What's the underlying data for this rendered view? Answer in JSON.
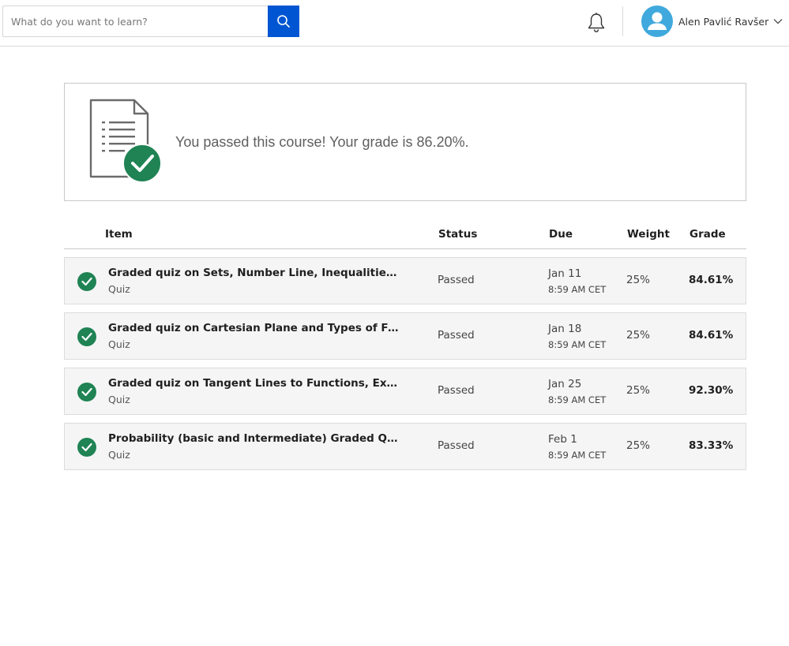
{
  "header": {
    "search_placeholder": "What do you want to learn?",
    "user_name": "Alen Pavlić Ravšer"
  },
  "banner": {
    "message": "You passed this course! Your grade is 86.20%."
  },
  "table": {
    "columns": {
      "item": "Item",
      "status": "Status",
      "due": "Due",
      "weight": "Weight",
      "grade": "Grade"
    },
    "rows": [
      {
        "title": "Graded quiz on Sets, Number Line, Inequalities, Si...",
        "type": "Quiz",
        "status": "Passed",
        "due_date": "Jan 11",
        "due_time": "8:59 AM CET",
        "weight": "25%",
        "grade": "84.61%"
      },
      {
        "title": "Graded quiz on Cartesian Plane and Types of Funct...",
        "type": "Quiz",
        "status": "Passed",
        "due_date": "Jan 18",
        "due_time": "8:59 AM CET",
        "weight": "25%",
        "grade": "84.61%"
      },
      {
        "title": "Graded quiz on Tangent Lines to Functions, Expone...",
        "type": "Quiz",
        "status": "Passed",
        "due_date": "Jan 25",
        "due_time": "8:59 AM CET",
        "weight": "25%",
        "grade": "92.30%"
      },
      {
        "title": "Probability (basic and Intermediate) Graded Quiz",
        "type": "Quiz",
        "status": "Passed",
        "due_date": "Feb 1",
        "due_time": "8:59 AM CET",
        "weight": "25%",
        "grade": "83.33%"
      }
    ]
  },
  "icons": {
    "search": "search-icon",
    "notifications": "bell-icon",
    "avatar": "user-avatar-icon",
    "menu": "chevron-down-icon",
    "status": "check-circle-icon",
    "banner": "document-check-icon"
  },
  "colors": {
    "primary_blue": "#0056d2",
    "success_green": "#1f8354",
    "avatar_blue": "#3fa9dd",
    "row_background": "#f5f5f5"
  }
}
